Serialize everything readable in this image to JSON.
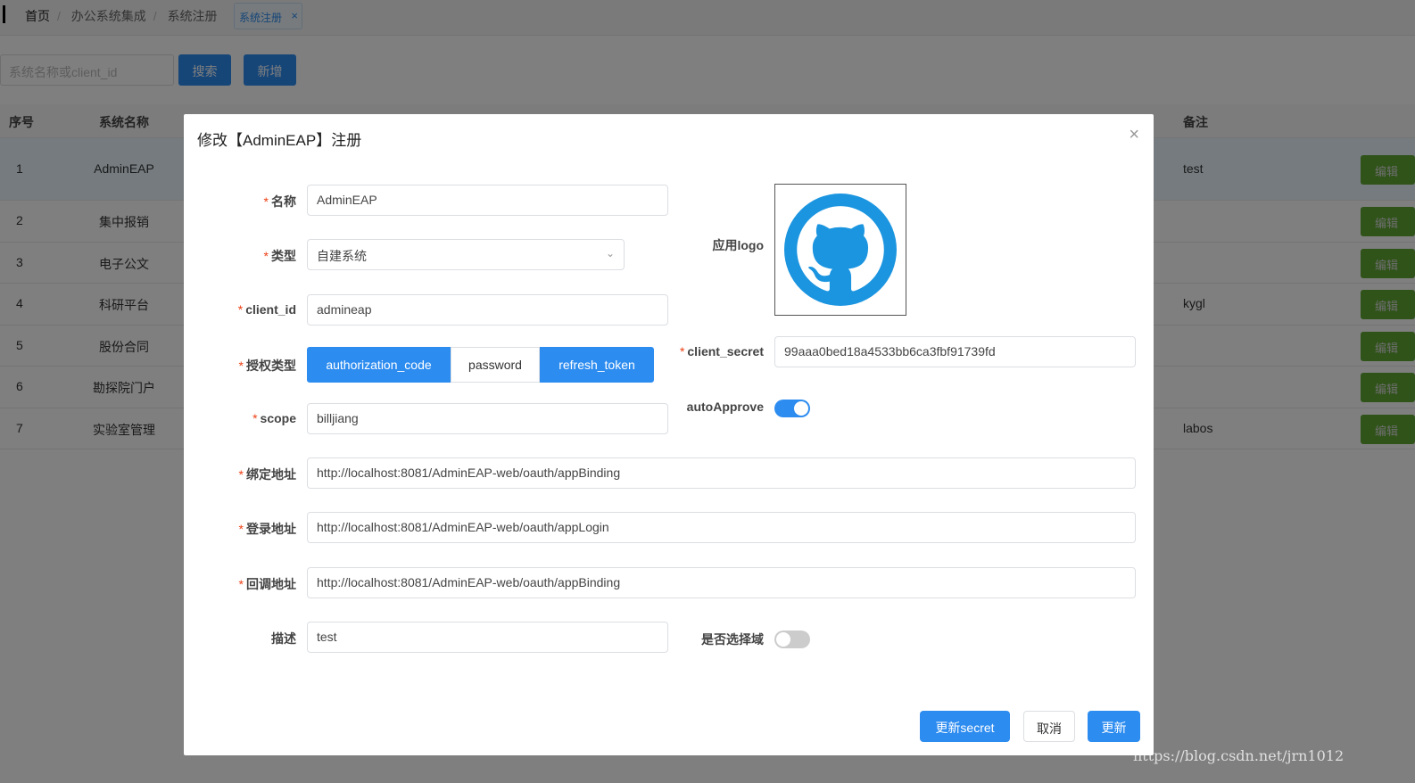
{
  "breadcrumb": [
    "首页",
    "办公系统集成",
    "系统注册"
  ],
  "active_tab": {
    "label": "系统注册",
    "close": "×"
  },
  "toolbar": {
    "search_placeholder": "系统名称或client_id",
    "search_label": "搜索",
    "add_label": "新增"
  },
  "table": {
    "headers": [
      "序号",
      "系统名称",
      "备注"
    ],
    "rows": [
      [
        "1",
        "AdminEAP",
        "test"
      ],
      [
        "2",
        "集中报销",
        ""
      ],
      [
        "3",
        "电子公文",
        ""
      ],
      [
        "4",
        "科研平台",
        "kygl"
      ],
      [
        "5",
        "股份合同",
        ""
      ],
      [
        "6",
        "勘探院门户",
        ""
      ],
      [
        "7",
        "实验室管理",
        "labos"
      ]
    ],
    "edit_label": "编辑"
  },
  "modal": {
    "title": "修改【AdminEAP】注册",
    "close": "×",
    "fields": {
      "name": {
        "label": "名称",
        "value": "AdminEAP"
      },
      "type": {
        "label": "类型",
        "value": "自建系统"
      },
      "client_id": {
        "label": "client_id",
        "value": "admineap"
      },
      "grant": {
        "label": "授权类型",
        "options": [
          "authorization_code",
          "password",
          "refresh_token"
        ],
        "selected": [
          "authorization_code",
          "refresh_token"
        ]
      },
      "scope": {
        "label": "scope",
        "value": "billjiang"
      },
      "bind_url": {
        "label": "绑定地址",
        "value": "http://localhost:8081/AdminEAP-web/oauth/appBinding"
      },
      "login_url": {
        "label": "登录地址",
        "value": "http://localhost:8081/AdminEAP-web/oauth/appLogin"
      },
      "callback_url": {
        "label": "回调地址",
        "value": "http://localhost:8081/AdminEAP-web/oauth/appBinding"
      },
      "desc": {
        "label": "描述",
        "value": "test"
      },
      "logo": {
        "label": "应用logo",
        "icon": "github-octocat-icon"
      },
      "client_secret": {
        "label": "client_secret",
        "value": "99aaa0bed18a4533bb6ca3fbf91739fd"
      },
      "auto_approve": {
        "label": "autoApprove",
        "on": true
      },
      "select_domain": {
        "label": "是否选择域",
        "on": false
      }
    },
    "buttons": {
      "refresh_secret": "更新secret",
      "cancel": "取消",
      "update": "更新"
    }
  },
  "watermark": "https://blog.csdn.net/jrn1012",
  "colors": {
    "primary": "#2d8cf0",
    "edit": "#5fa732",
    "required": "#ed3f14"
  }
}
